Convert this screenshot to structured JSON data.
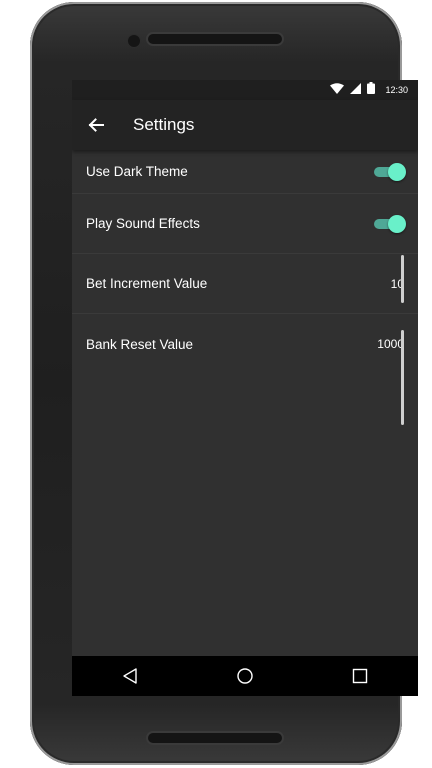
{
  "status_bar": {
    "time": "12:30",
    "icons": [
      "wifi-icon",
      "signal-icon",
      "battery-icon"
    ]
  },
  "app_bar": {
    "title": "Settings",
    "back_icon": "arrow-back-icon"
  },
  "settings": {
    "dark_theme": {
      "label": "Use Dark Theme",
      "enabled": true
    },
    "sound_effects": {
      "label": "Play Sound Effects",
      "enabled": true
    },
    "bet_increment": {
      "label": "Bet Increment Value",
      "value": "10"
    },
    "bank_reset": {
      "label": "Bank Reset Value",
      "value": "1000"
    }
  },
  "nav_bar": {
    "icons": [
      "back-triangle-icon",
      "home-circle-icon",
      "recents-square-icon"
    ]
  },
  "colors": {
    "background": "#303030",
    "app_bar": "#232323",
    "accent": "#69f0c9",
    "switch_track": "#4fa896",
    "text": "#ffffff"
  }
}
